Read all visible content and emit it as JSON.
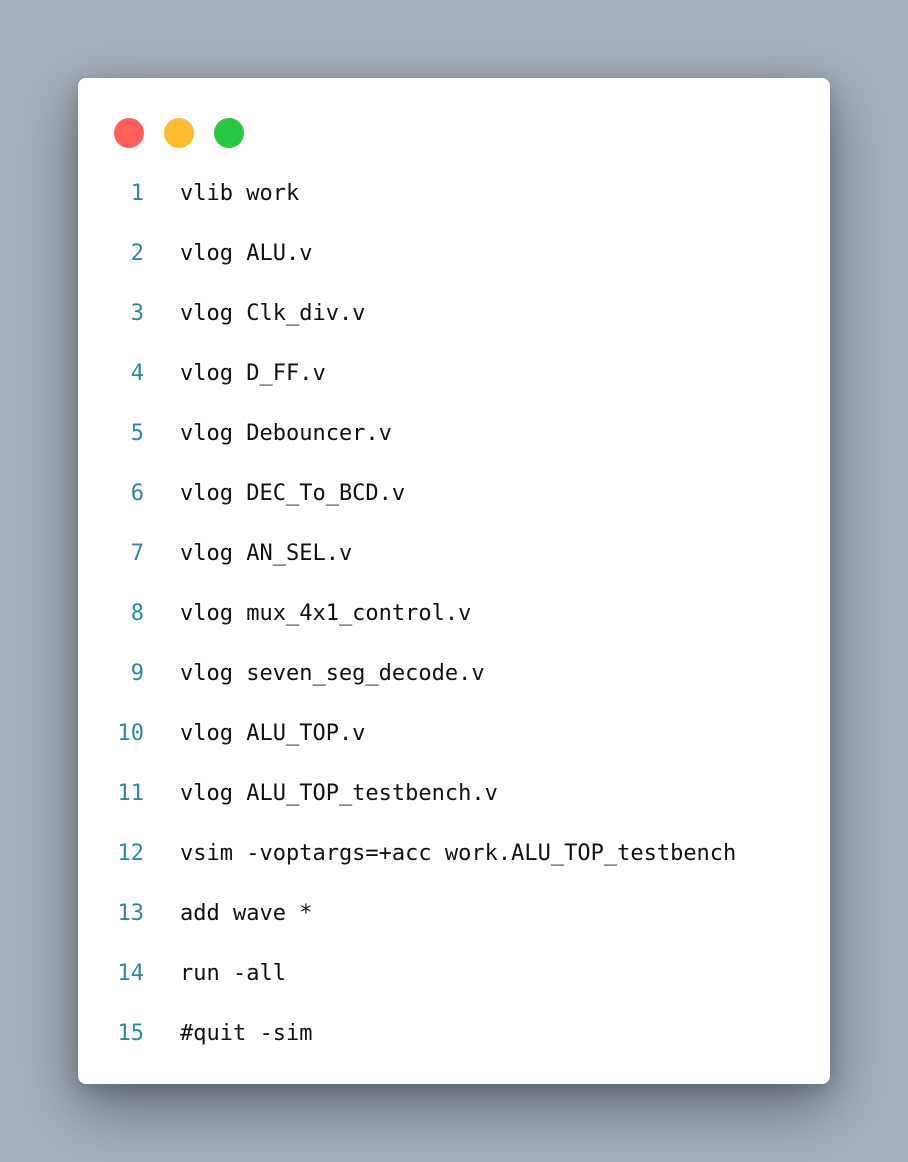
{
  "window_controls": [
    {
      "name": "close",
      "color": "#ff5f57"
    },
    {
      "name": "minimize",
      "color": "#febc2e"
    },
    {
      "name": "zoom",
      "color": "#28c840"
    }
  ],
  "accent_color": "#2a8aa0",
  "code_lines": [
    {
      "num": "1",
      "text": "vlib work"
    },
    {
      "num": "2",
      "text": "vlog ALU.v"
    },
    {
      "num": "3",
      "text": "vlog Clk_div.v"
    },
    {
      "num": "4",
      "text": "vlog D_FF.v"
    },
    {
      "num": "5",
      "text": "vlog Debouncer.v"
    },
    {
      "num": "6",
      "text": "vlog DEC_To_BCD.v"
    },
    {
      "num": "7",
      "text": "vlog AN_SEL.v"
    },
    {
      "num": "8",
      "text": "vlog mux_4x1_control.v"
    },
    {
      "num": "9",
      "text": "vlog seven_seg_decode.v"
    },
    {
      "num": "10",
      "text": "vlog ALU_TOP.v"
    },
    {
      "num": "11",
      "text": "vlog ALU_TOP_testbench.v"
    },
    {
      "num": "12",
      "text": "vsim -voptargs=+acc work.ALU_TOP_testbench"
    },
    {
      "num": "13",
      "text": "add wave *"
    },
    {
      "num": "14",
      "text": "run -all"
    },
    {
      "num": "15",
      "text": "#quit -sim"
    }
  ]
}
